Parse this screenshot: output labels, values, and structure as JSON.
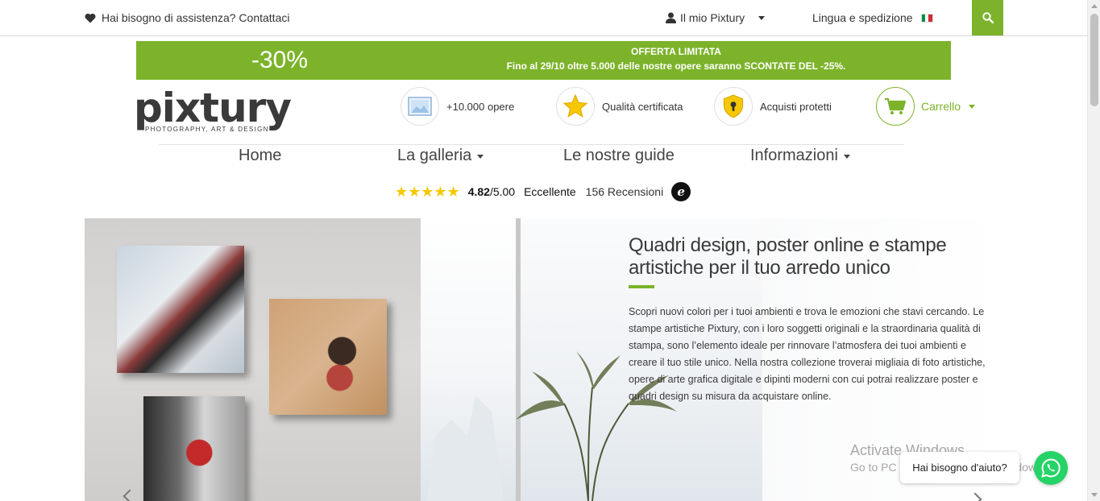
{
  "topbar": {
    "help_text": "Hai bisogno di assistenza? Contattaci",
    "account_label": "Il mio Pixtury",
    "language_label": "Lingua e spedizione"
  },
  "promo": {
    "discount": "-30%",
    "title": "OFFERTA LIMITATA",
    "subtitle": "Fino al 29/10 oltre 5.000 delle nostre opere saranno SCONTATE DEL -25%."
  },
  "logo": {
    "name": "pixtury",
    "tagline": "PHOTOGRAPHY, ART & DESIGN"
  },
  "features": [
    {
      "label": "+10.000 opere",
      "icon": "picture-icon"
    },
    {
      "label": "Qualità certificata",
      "icon": "star-icon"
    },
    {
      "label": "Acquisti protetti",
      "icon": "shield-lock-icon"
    }
  ],
  "cart": {
    "label": "Carrello"
  },
  "nav": {
    "home": "Home",
    "gallery": "La galleria",
    "guides": "Le nostre guide",
    "info": "Informazioni"
  },
  "rating": {
    "stars": "★★★★★",
    "score": "4.82",
    "max": "/5.00",
    "verdict": "Eccellente",
    "reviews": "156 Recensioni",
    "badge": "e"
  },
  "hero": {
    "title": "Quadri design, poster online e stampe artistiche per il tuo arredo unico",
    "text": "Scopri nuovi colori per i tuoi ambienti e trova le emozioni che stavi cercando. Le stampe artistiche Pixtury, con i loro soggetti originali e la straordinaria qualità di stampa, sono l’elemento ideale per rinnovare l’atmosfera dei tuoi ambienti e creare il tuo stile unico. Nella nostra collezione troverai migliaia di foto artistiche, opere di arte grafica digitale e dipinti moderni con cui potrai realizzare poster e quadri design su misura da acquistare online."
  },
  "watermark": {
    "line1": "Activate Windows",
    "line2": "Go to PC settings to activate Windows."
  },
  "chat": {
    "label": "Hai bisogno d'aiuto?"
  },
  "colors": {
    "accent": "#7cb32a",
    "whatsapp": "#25d366",
    "star": "#f6c800"
  }
}
